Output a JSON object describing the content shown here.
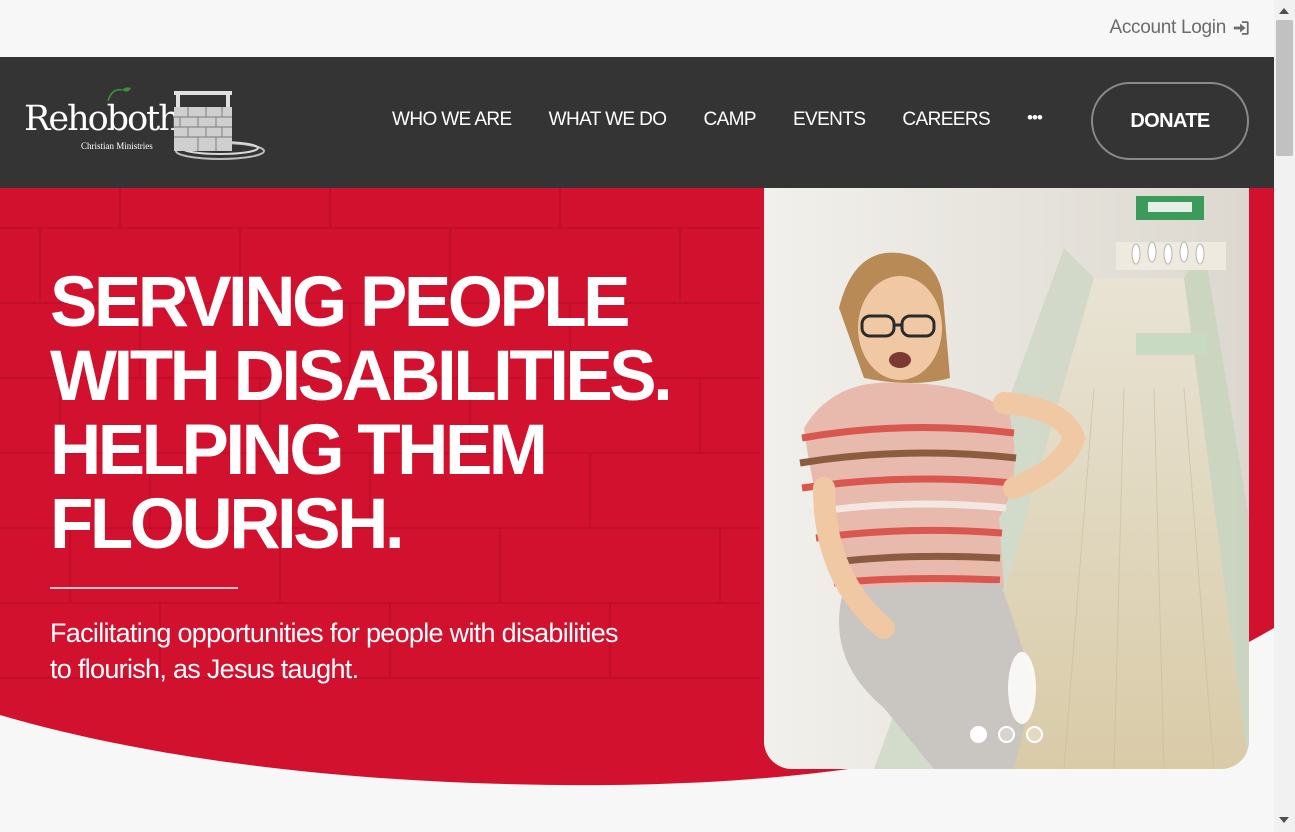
{
  "topbar": {
    "account_login": "Account Login",
    "account_icon": "sign-in-icon"
  },
  "logo": {
    "wordmark": "Rehoboth",
    "subtitle": "Christian Ministries",
    "icon": "well-icon"
  },
  "nav": {
    "items": [
      {
        "label": "WHO WE ARE"
      },
      {
        "label": "WHAT WE DO"
      },
      {
        "label": "CAMP"
      },
      {
        "label": "EVENTS"
      },
      {
        "label": "CAREERS"
      }
    ],
    "more_label": "•••",
    "donate_label": "DONATE"
  },
  "hero": {
    "headline": [
      "SERVING PEOPLE",
      "WITH DISABILITIES.",
      "HELPING THEM",
      "FLOURISH."
    ],
    "subtext_lines": [
      "Facilitating opportunities for people with disabilities",
      "to flourish, as Jesus taught."
    ],
    "slides": {
      "count": 3,
      "active": 1
    }
  },
  "colors": {
    "header_bg": "#343434",
    "hero_red": "#d2112f",
    "page_bg": "#f7f7f7",
    "text_white": "#ffffff"
  }
}
